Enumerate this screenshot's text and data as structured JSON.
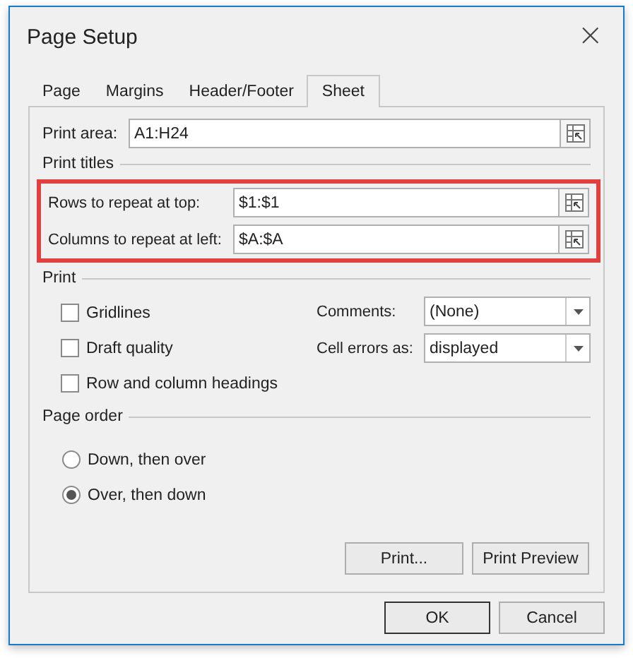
{
  "window": {
    "title": "Page Setup",
    "close": "×"
  },
  "tabs": [
    {
      "label": "Page",
      "selected": false
    },
    {
      "label": "Margins",
      "selected": false
    },
    {
      "label": "Header/Footer",
      "selected": false
    },
    {
      "label": "Sheet",
      "selected": true
    }
  ],
  "print_area": {
    "label": "Print area:",
    "value": "A1:H24"
  },
  "print_titles": {
    "label": "Print titles",
    "highlighted": true,
    "fields": [
      {
        "label": "Rows to repeat at top:",
        "value": "$1:$1"
      },
      {
        "label": "Columns to repeat at left:",
        "value": "$A:$A"
      }
    ]
  },
  "print": {
    "label": "Print",
    "checkboxes": [
      {
        "label": "Gridlines",
        "checked": false
      },
      {
        "label": "Draft quality",
        "checked": false
      },
      {
        "label": "Row and column headings",
        "checked": false
      }
    ],
    "dropdowns": [
      {
        "label": "Comments:",
        "value": "(None)"
      },
      {
        "label": "Cell errors as:",
        "value": "displayed"
      }
    ]
  },
  "page_order": {
    "label": "Page order",
    "options": [
      {
        "label": "Down, then over",
        "selected": false
      },
      {
        "label": "Over, then down",
        "selected": true
      }
    ]
  },
  "panel_buttons": [
    "Print...",
    "Print Preview"
  ],
  "dialog_buttons": [
    {
      "label": "OK",
      "default": true
    },
    {
      "label": "Cancel",
      "default": false
    }
  ]
}
